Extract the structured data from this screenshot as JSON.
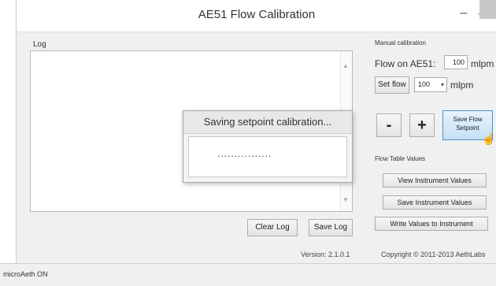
{
  "window": {
    "title": "AE51 Flow Calibration",
    "minimize_glyph": "–",
    "maximize_glyph": "▫"
  },
  "log": {
    "label": "Log",
    "clear_label": "Clear Log",
    "save_label": "Save Log"
  },
  "dialog": {
    "title": "Saving setpoint calibration...",
    "progress_text": "................"
  },
  "manual": {
    "group_label": "Manual calibration",
    "flow_label": "Flow on AE51:",
    "flow_value": "100",
    "flow_unit": "mlpm",
    "set_flow_label": "Set flow",
    "select_value": "100",
    "select_unit": "mlpm",
    "minus_label": "-",
    "plus_label": "+",
    "save_setpoint_label": "Save Flow Setpoint"
  },
  "flow_table": {
    "group_label": "Flow Table Values",
    "view_label": "View Instrument Values",
    "save_label": "Save Instrument Values",
    "write_label": "Write Values to Instrument"
  },
  "footer": {
    "version": "Version: 2.1.0.1",
    "copyright": "Copyright © 2011-2013  AethLabs"
  },
  "status": {
    "text": "microAeth ON"
  }
}
